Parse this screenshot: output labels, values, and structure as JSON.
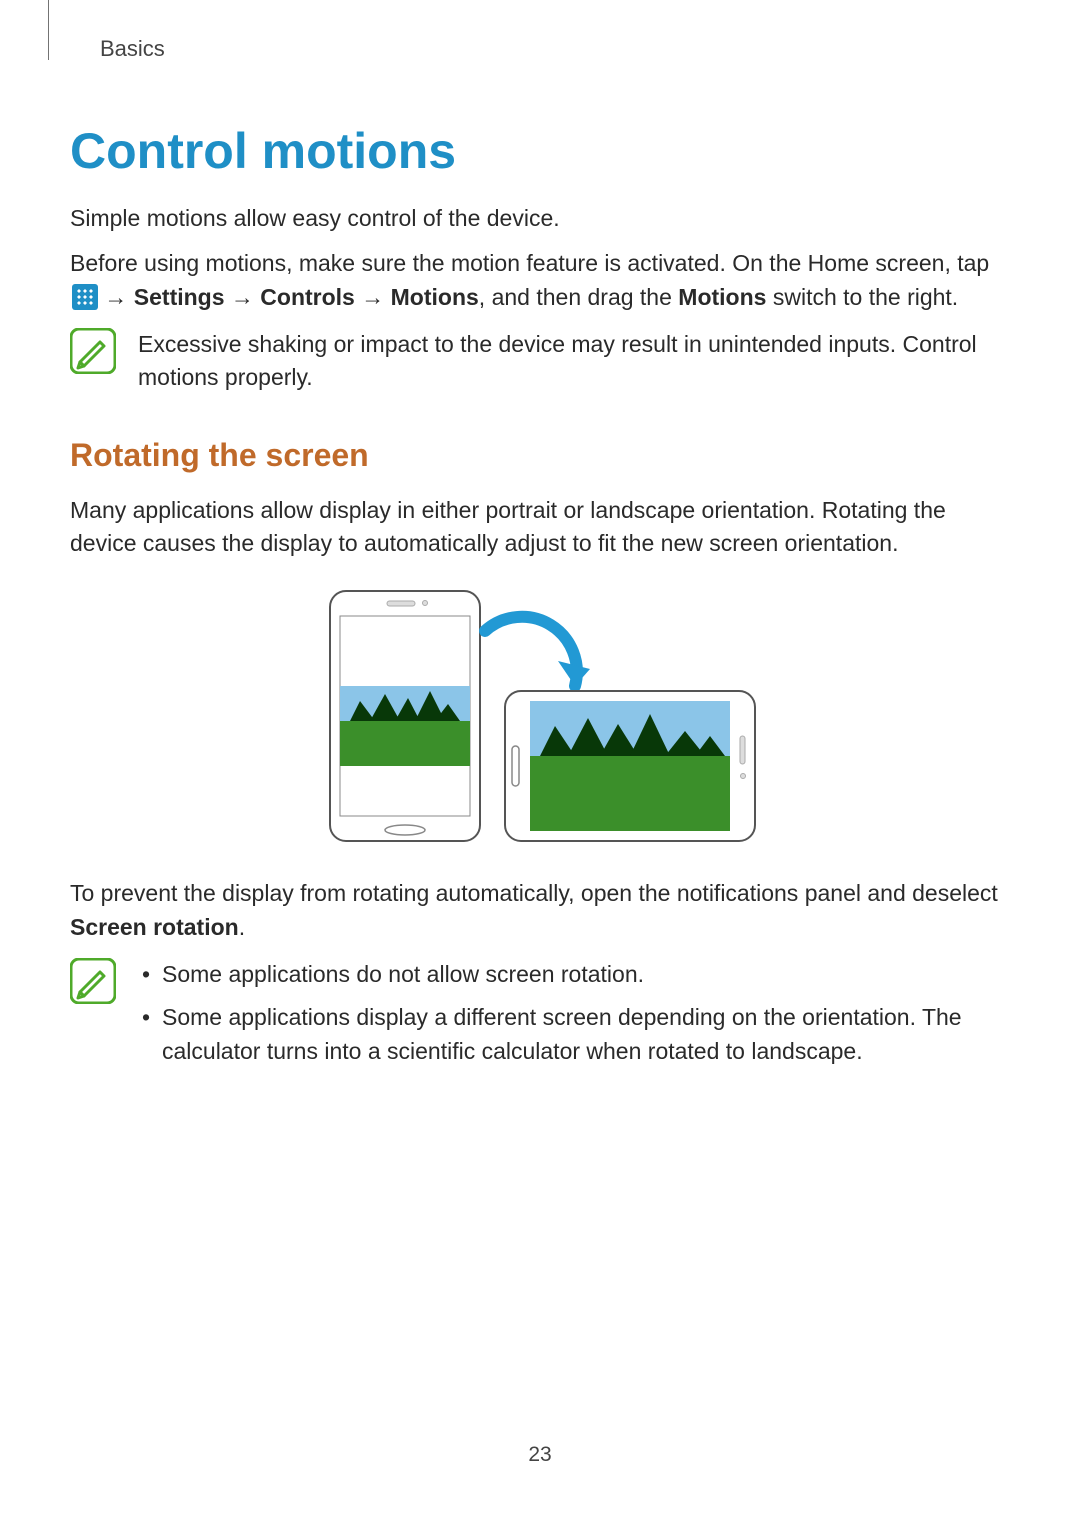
{
  "page": {
    "chapter": "Basics",
    "title": "Control motions",
    "intro_p1": "Simple motions allow easy control of the device.",
    "intro_p2_a": "Before using motions, make sure the motion feature is activated. On the Home screen, tap ",
    "intro_p2_b": " → ",
    "intro_p2_settings": "Settings",
    "intro_p2_arrow2": " → ",
    "intro_p2_controls": "Controls",
    "intro_p2_arrow3": " → ",
    "intro_p2_motions": "Motions",
    "intro_p2_c": ", and then drag the ",
    "intro_p2_motions2": "Motions",
    "intro_p2_d": " switch to the right.",
    "note1": "Excessive shaking or impact to the device may result in unintended inputs. Control motions properly.",
    "subhead": "Rotating the screen",
    "rot_p1": "Many applications allow display in either portrait or landscape orientation. Rotating the device causes the display to automatically adjust to fit the new screen orientation.",
    "rot_p2_a": "To prevent the display from rotating automatically, open the notifications panel and deselect ",
    "rot_p2_b": "Screen rotation",
    "rot_p2_c": ".",
    "note2_item1": "Some applications do not allow screen rotation.",
    "note2_item2": "Some applications display a different screen depending on the orientation. The calculator turns into a scientific calculator when rotated to landscape.",
    "page_number": "23"
  },
  "icons": {
    "apps_icon_name": "apps-grid-icon",
    "note_icon_name": "note-pencil-icon"
  }
}
